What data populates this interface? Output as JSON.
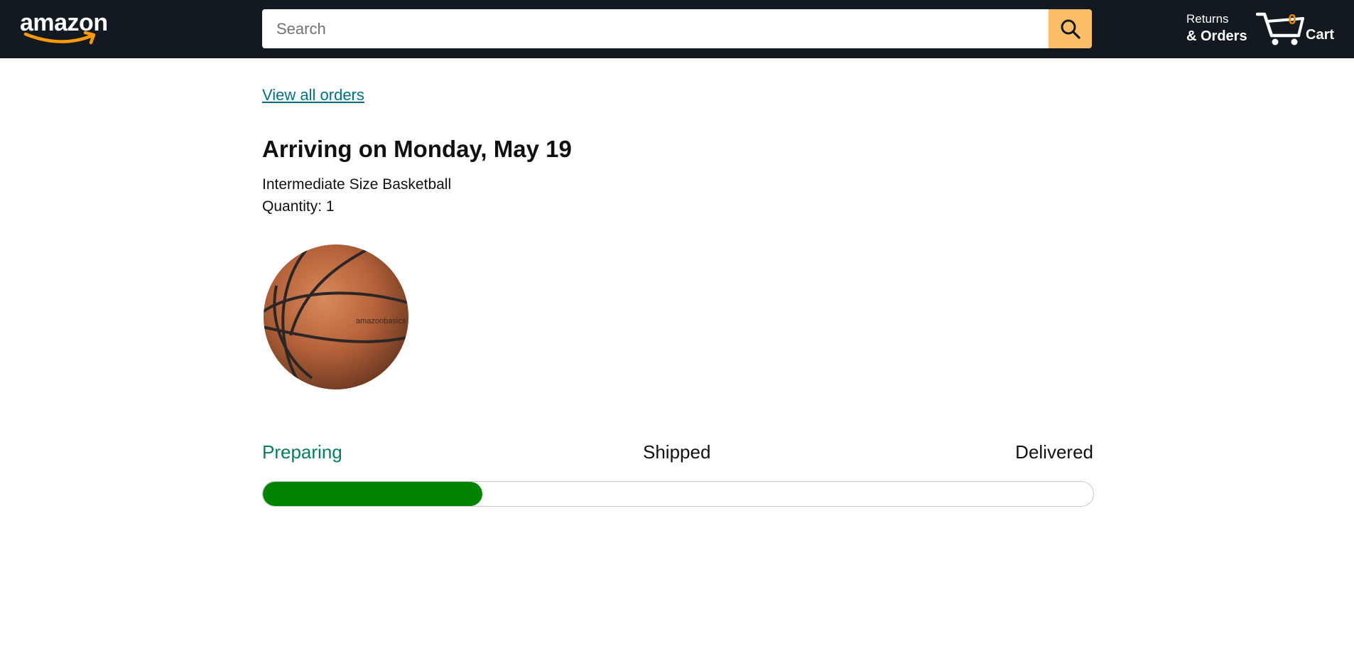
{
  "header": {
    "logo_text": "amazon",
    "search_placeholder": "Search",
    "returns_line1": "Returns",
    "returns_line2": "& Orders",
    "cart_count": "0",
    "cart_label": "Cart"
  },
  "order": {
    "view_all_link": "View all orders",
    "arrival_heading": "Arriving on Monday, May 19",
    "item_name": "Intermediate Size Basketball",
    "quantity": "Quantity: 1",
    "image_alt": "basketball-product-image",
    "image_text": "amazonbasics"
  },
  "progress": {
    "stages": [
      "Preparing",
      "Shipped",
      "Delivered"
    ],
    "current_stage": "Preparing",
    "fill_fraction": 0.264
  },
  "colors": {
    "header_bg": "#131921",
    "search_button": "#febd69",
    "cart_count": "#f08804",
    "link": "#007185",
    "active_stage": "#067d62",
    "progress_fill": "#008300"
  },
  "icons": {
    "search": "search-icon",
    "cart": "cart-icon",
    "logo_smile": "amazon-smile-arrow"
  }
}
